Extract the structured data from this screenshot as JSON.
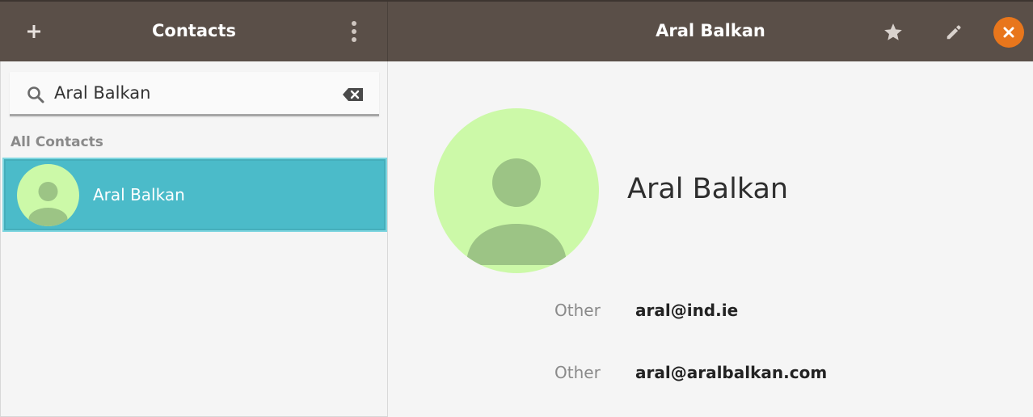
{
  "header": {
    "add_icon": "plus-icon",
    "contacts_title": "Contacts",
    "menu_icon": "vertical-dots-icon",
    "contact_title": "Aral Balkan",
    "star_icon": "star-icon",
    "edit_icon": "pencil-icon",
    "close_icon": "close-icon",
    "accent_color": "#e8761c"
  },
  "search": {
    "value": "Aral Balkan",
    "icon": "search-icon",
    "clear_icon": "clear-text-icon"
  },
  "sidebar": {
    "section_label": "All Contacts",
    "contacts": [
      {
        "name": "Aral Balkan",
        "selected": true
      }
    ],
    "selection_color": "#4bbbc9"
  },
  "detail": {
    "name": "Aral Balkan",
    "emails": [
      {
        "type": "Other",
        "value": "aral@ind.ie"
      },
      {
        "type": "Other",
        "value": "aral@aralbalkan.com"
      }
    ]
  }
}
